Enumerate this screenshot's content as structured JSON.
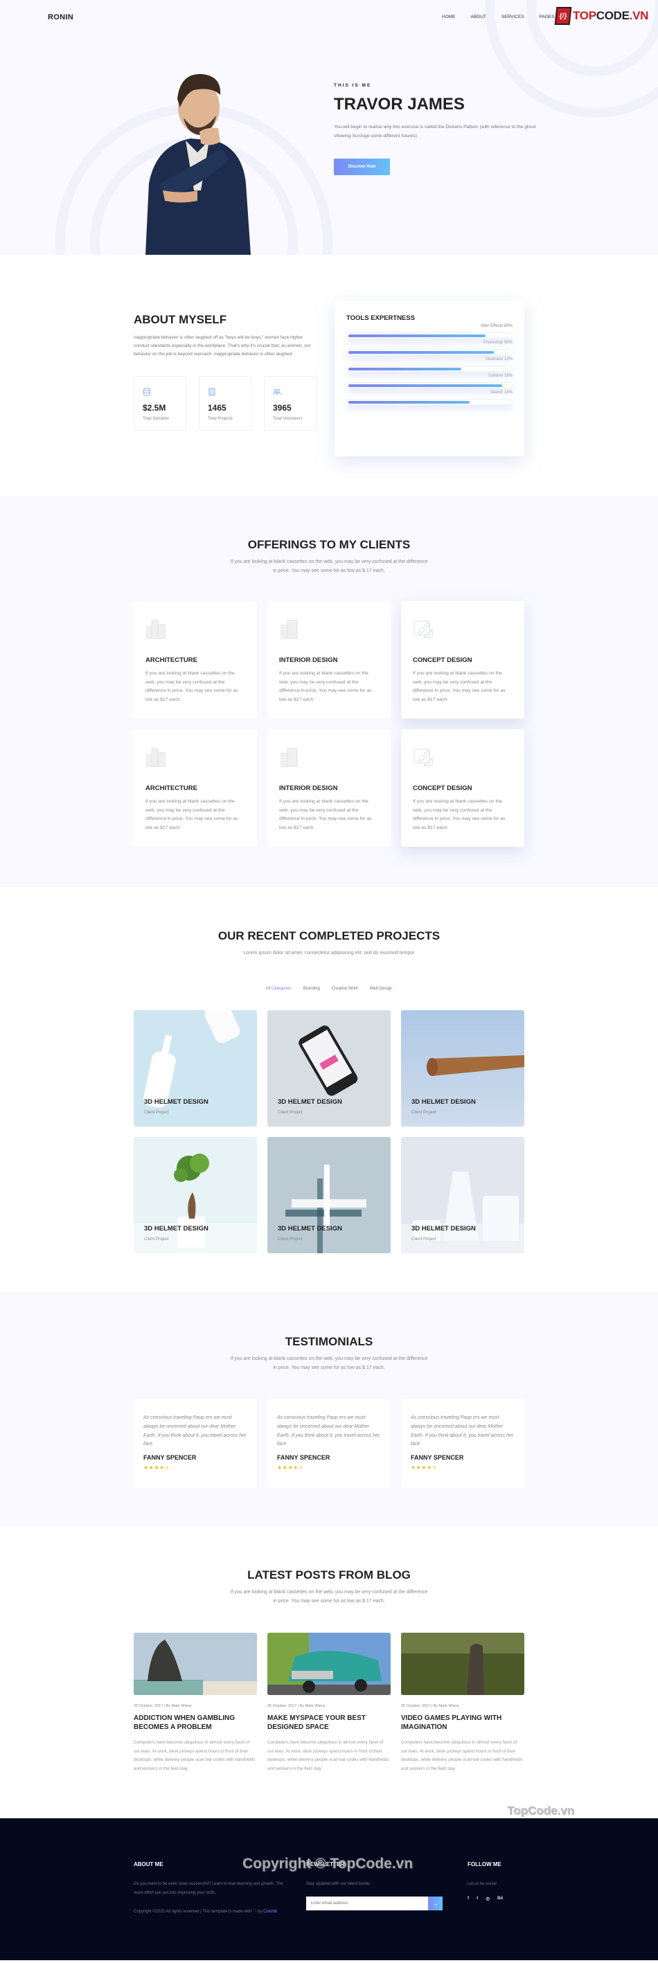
{
  "header": {
    "logo": "RONIN",
    "nav": [
      "HOME",
      "ABOUT",
      "SERVICES",
      "PAGES"
    ],
    "brand_icon": "{/}",
    "brand_red": "TOP",
    "brand_dark": "CODE",
    "brand_suffix": ".VN"
  },
  "hero": {
    "kicker": "THIS IS ME",
    "title": "TRAVOR JAMES",
    "description": "You will begin to realise why this exercise is called the Dickens Pattern (with reference to the ghost showing Scrooge some different futures)",
    "button": "Discover Now"
  },
  "about": {
    "title": "ABOUT MYSELF",
    "description": "inappropriate behavior is often laughed off as \"boys will be boys,\" women face higher conduct standards especially in the workplace. That's why it's crucial that, as women, our behavior on the job is beyond reproach. inappropriate behavior is often laughed.",
    "stats": [
      {
        "icon": "database-icon",
        "value": "$2.5M",
        "label": "Total Donation"
      },
      {
        "icon": "book-icon",
        "value": "1465",
        "label": "Total Projects"
      },
      {
        "icon": "users-icon",
        "value": "3965",
        "label": "Total Volunteers"
      }
    ],
    "tools": {
      "title": "TOOLS EXPERTNESS",
      "items": [
        {
          "label": "After Effects 85%",
          "fill": 0.85
        },
        {
          "label": "Photoshop 90%",
          "fill": 0.9
        },
        {
          "label": "Illustrator 13%",
          "fill": 0.7
        },
        {
          "label": "Sublime 18%",
          "fill": 0.95
        },
        {
          "label": "Sketch 14%",
          "fill": 0.75
        }
      ]
    }
  },
  "offerings": {
    "title": "OFFERINGS TO MY CLIENTS",
    "subtitle": "If you are looking at blank cassettes on the web, you may be very confused at the difference in price. You may see some for as low as $.17 each.",
    "cards": [
      {
        "icon": "buildings-icon",
        "title": "ARCHITECTURE",
        "desc": "If you are looking at blank cassettes on the web, you may be very confused at the difference in price. You may see some for as low as $17 each."
      },
      {
        "icon": "office-building-icon",
        "title": "INTERIOR DESIGN",
        "desc": "If you are looking at blank cassettes on the web, you may be very confused at the difference in price. You may see some for as low as $17 each."
      },
      {
        "icon": "drafting-icon",
        "title": "CONCEPT DESIGN",
        "desc": "If you are looking at blank cassettes on the web, you may be very confused at the difference in price. You may see some for as low as $17 each."
      },
      {
        "icon": "buildings-icon",
        "title": "ARCHITECTURE",
        "desc": "If you are looking at blank cassettes on the web, you may be very confused at the difference in price. You may see some for as low as $17 each."
      },
      {
        "icon": "office-building-icon",
        "title": "INTERIOR DESIGN",
        "desc": "If you are looking at blank cassettes on the web, you may be very confused at the difference in price. You may see some for as low as $17 each."
      },
      {
        "icon": "drafting-icon",
        "title": "CONCEPT DESIGN",
        "desc": "If you are looking at blank cassettes on the web, you may be very confused at the difference in price. You may see some for as low as $17 each."
      }
    ]
  },
  "projects": {
    "title": "OUR RECENT COMPLETED PROJECTS",
    "subtitle": "Lorem ipsum dolor sit amet, consectetur adipisicing elit, sed do eiusmod tempor",
    "filters": [
      "All Categories",
      "Branding",
      "Creative Work",
      "Web Design"
    ],
    "active_filter": "All Categories",
    "items": [
      {
        "title": "3D HELMET DESIGN",
        "sub": "Client Project",
        "image": "bottles-photo",
        "bg": "#cde6f2"
      },
      {
        "title": "3D HELMET DESIGN",
        "sub": "Client Project",
        "image": "phone-photo",
        "bg": "#d6dde3"
      },
      {
        "title": "3D HELMET DESIGN",
        "sub": "Client Project",
        "image": "wood-object-photo",
        "bg": "#b7d0ea"
      },
      {
        "title": "3D HELMET DESIGN",
        "sub": "Client Project",
        "image": "bonsai-photo",
        "bg": "#e7f3f5"
      },
      {
        "title": "3D HELMET DESIGN",
        "sub": "Client Project",
        "image": "pen-ruler-photo",
        "bg": "#bccbd3"
      },
      {
        "title": "3D HELMET DESIGN",
        "sub": "Client Project",
        "image": "vases-photo",
        "bg": "#e2e7ef"
      }
    ]
  },
  "testimonials": {
    "title": "TESTIMONIALS",
    "subtitle": "If you are looking at blank cassettes on the web, you may be very confused at the difference in price. You may see some for as low as $.17 each.",
    "items": [
      {
        "quote": "As conscious traveling Paup ers we must always be oncemed about our dear Mother Earth. If you think about it, you travel across her face",
        "name": "FANNY SPENCER",
        "rating": 4.5
      },
      {
        "quote": "As conscious traveling Paup ers we must always be oncemed about our dear Mother Earth. If you think about it, you travel across her face",
        "name": "FANNY SPENCER",
        "rating": 4.5
      },
      {
        "quote": "As conscious traveling Paup ers we must always be oncemed about our dear Mother Earth. If you think about it, you travel across her face",
        "name": "FANNY SPENCER",
        "rating": 4.5
      }
    ]
  },
  "blog": {
    "title": "LATEST POSTS FROM BLOG",
    "subtitle": "If you are looking at blank cassettes on the web, you may be very confused at the difference in price. You may see some for as low as $.17 each.",
    "posts": [
      {
        "image": "beach-rock-photo",
        "meta": "25 October, 2017 | By Mark Wiens",
        "title": "ADDICTION WHEN GAMBLING BECOMES A PROBLEM",
        "desc": "Computers have become ubiquitous in almost every facet of our lives. At work, desk jockeys spend hours in front of their desktops, while delivery people scan bar codes with handhelds and workers in the field stay"
      },
      {
        "image": "classic-car-photo",
        "meta": "25 October, 2017 | By Mark Wiens",
        "title": "MAKE MYSPACE YOUR BEST DESIGNED SPACE",
        "desc": "Computers have become ubiquitous in almost every facet of our lives. At work, desk jockeys spend hours in front of their desktops, while delivery people scan bar codes with handhelds and workers in the field stay"
      },
      {
        "image": "forest-rock-photo",
        "meta": "25 October, 2017 | By Mark Wiens",
        "title": "VIDEO GAMES PLAYING WITH IMAGINATION",
        "desc": "Computers have become ubiquitous in almost every facet of our lives. At work, desk jockeys spend hours in front of their desktops, while delivery people scan bar codes with handhelds and workers in the field stay"
      }
    ]
  },
  "footer": {
    "about_title": "ABOUT ME",
    "about_text": "Do you want to be even more successful? Learn to love learning and growth. The more effort you put into improving your skills,",
    "copyright": "Copyright ©2021 All rights reserved | This template is made with ♡ by",
    "copyright_link": "Colorlib",
    "newsletter_title": "NEWSLETTER",
    "newsletter_text": "Stay updated with our latest trends",
    "email_placeholder": "Enter email address",
    "submit_icon": "→",
    "follow_title": "FOLLOW ME",
    "follow_text": "Let us be social",
    "social": [
      "f",
      "t",
      "◎",
      "Bē"
    ]
  },
  "watermarks": {
    "small": "TopCode.vn",
    "large": "Copyright © TopCode.vn"
  },
  "colors": {
    "accent_start": "#7b8cf5",
    "accent_end": "#65c0f9",
    "star": "#f5b81d",
    "footer_bg": "#04091e",
    "section_tint": "#f9f9ff"
  }
}
